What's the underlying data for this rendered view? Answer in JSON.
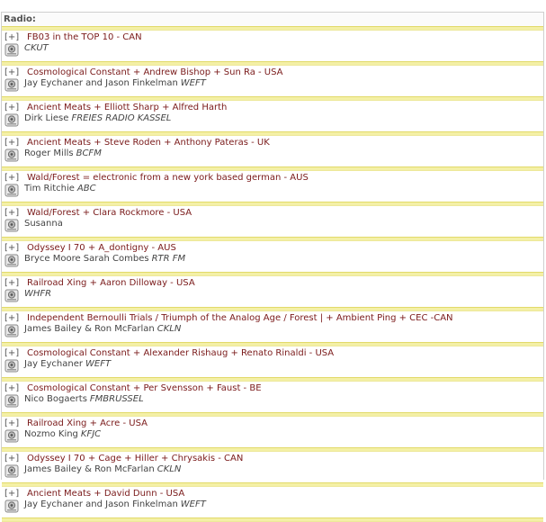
{
  "section_title": "Radio:",
  "toggle_label": "[+]",
  "items": [
    {
      "title": "FB03 in the TOP 10 - CAN",
      "djs": "",
      "station": "CKUT"
    },
    {
      "title": "Cosmological Constant + Andrew Bishop + Sun Ra - USA",
      "djs": "Jay Eychaner and Jason Finkelman",
      "station": "WEFT"
    },
    {
      "title": "Ancient Meats + Elliott Sharp + Alfred Harth",
      "djs": "Dirk Liese",
      "station": "FREIES RADIO KASSEL"
    },
    {
      "title": "Ancient Meats + Steve Roden + Anthony Pateras - UK",
      "djs": "Roger Mills",
      "station": "BCFM"
    },
    {
      "title": "Wald/Forest = electronic from a new york based german - AUS",
      "djs": "Tim Ritchie",
      "station": "ABC"
    },
    {
      "title": "Wald/Forest + Clara Rockmore - USA",
      "djs": "Susanna",
      "station": ""
    },
    {
      "title": "Odyssey I 70 + A_dontigny - AUS",
      "djs": "Bryce Moore Sarah Combes",
      "station": "RTR FM"
    },
    {
      "title": "Railroad Xing + Aaron Dilloway - USA",
      "djs": "",
      "station": "WHFR"
    },
    {
      "title": "Independent Bernoulli Trials / Triumph of the Analog Age / Forest | + Ambient Ping + CEC -CAN",
      "djs": "James Bailey & Ron McFarlan",
      "station": "CKLN"
    },
    {
      "title": "Cosmological Constant + Alexander Rishaug + Renato Rinaldi - USA",
      "djs": "Jay Eychaner",
      "station": "WEFT"
    },
    {
      "title": "Cosmological Constant + Per Svensson + Faust - BE",
      "djs": "Nico Bogaerts",
      "station": "FMBRUSSEL"
    },
    {
      "title": "Railroad Xing + Acre - USA",
      "djs": "Nozmo King",
      "station": "KFJC"
    },
    {
      "title": "Odyssey I 70 + Cage + Hiller + Chrysakis - CAN",
      "djs": "James Bailey & Ron McFarlan",
      "station": "CKLN"
    },
    {
      "title": "Ancient Meats + David Dunn - USA",
      "djs": "Jay Eychaner and Jason Finkelman",
      "station": "WEFT"
    }
  ]
}
